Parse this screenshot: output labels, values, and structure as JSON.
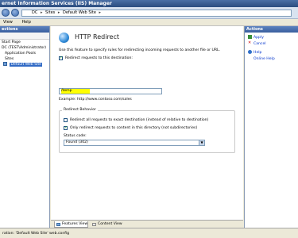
{
  "window": {
    "title": "ernet Information Services (IIS) Manager"
  },
  "address": {
    "parts": [
      "DC",
      "Sites",
      "Default Web Site"
    ]
  },
  "menu": {
    "items": [
      "View",
      "Help"
    ]
  },
  "connections": {
    "header": "ections",
    "tree": [
      "Start Page",
      "DC (TEST\\Administrator)",
      "Application Pools",
      "Sites",
      "Default Web Site"
    ]
  },
  "feature": {
    "title": "HTTP Redirect",
    "description": "Use this feature to specify rules for redirecting incoming requests to another file or URL.",
    "redirect_label": "Redirect requests to this destination:",
    "destination_value": "/temp",
    "example": "Example: http://www.contoso.com/sales",
    "behavior_legend": "Redirect Behavior",
    "exact_label": "Redirect all requests to exact destination (instead of relative to destination)",
    "only_dir_label": "Only redirect requests to content in this directory (not subdirectories)",
    "status_code_label": "Status code:",
    "status_code_value": "Found (302)"
  },
  "view_tabs": {
    "features": "Features View",
    "content": "Content View"
  },
  "actions": {
    "header": "Actions",
    "apply": "Apply",
    "cancel": "Cancel",
    "help": "Help",
    "online_help": "Online Help"
  },
  "status": {
    "text": "ration: 'Default Web Site' web.config"
  },
  "colors": {
    "accent": "#316ac5",
    "highlight": "#ffff00",
    "link": "#0033cc"
  }
}
